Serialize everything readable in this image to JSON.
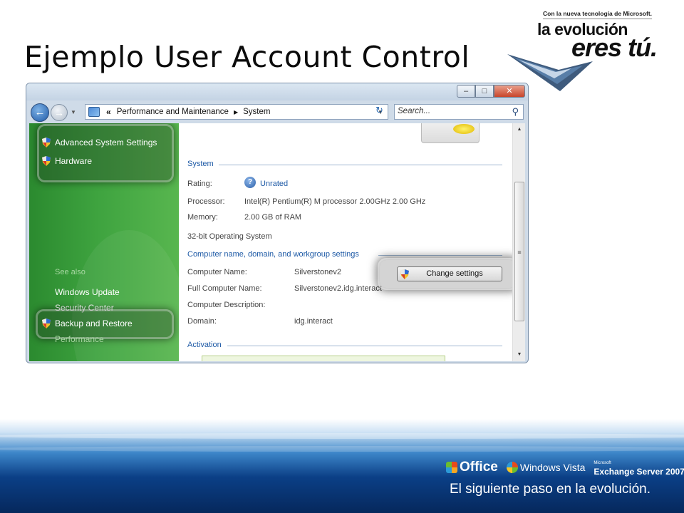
{
  "slide": {
    "title": "Ejemplo User Account Control"
  },
  "brand": {
    "tagline": "Con la nueva tecnología de Microsoft.",
    "line1": "la evolución",
    "line2": "eres tú."
  },
  "window": {
    "buttons": {
      "minimize": "–",
      "maximize": "□",
      "close": "✕"
    },
    "address": {
      "chevron": "«",
      "crumbs": [
        "Performance and Maintenance",
        "System"
      ]
    },
    "search": {
      "placeholder": "Search..."
    },
    "sidebar": {
      "tasks": [
        {
          "label": "Advanced System Settings",
          "icon": "uac-shield-icon"
        },
        {
          "label": "Hardware",
          "icon": "uac-shield-icon"
        }
      ],
      "see_also_heading": "See also",
      "see_also": [
        {
          "label": "Windows Update"
        },
        {
          "label": "Security Center"
        },
        {
          "label": "Backup and Restore",
          "icon": "uac-shield-icon"
        },
        {
          "label": "Performance"
        }
      ]
    },
    "system": {
      "heading": "System",
      "rating_label": "Rating:",
      "rating_value": "Unrated",
      "processor_label": "Processor:",
      "processor_value": "Intel(R) Pentium(R) M processor 2.00GHz   2.00 GHz",
      "memory_label": "Memory:",
      "memory_value": "2.00 GB of RAM",
      "os_type": "32-bit Operating System"
    },
    "computer_name": {
      "heading": "Computer name, domain, and workgroup settings",
      "name_label": "Computer Name:",
      "name_value": "Silverstonev2",
      "full_label": "Full Computer Name:",
      "full_value": "Silverstonev2.idg.interact",
      "desc_label": "Computer Description:",
      "desc_value": "",
      "domain_label": "Domain:",
      "domain_value": "idg.interact",
      "change_button": "Change settings"
    },
    "activation": {
      "heading": "Activation"
    }
  },
  "footer": {
    "product_office": "Office",
    "product_vista": "Windows Vista",
    "product_exchange_small": "Microsoft",
    "product_exchange": "Exchange Server 2007",
    "tagline": "El siguiente paso en la evolución."
  }
}
